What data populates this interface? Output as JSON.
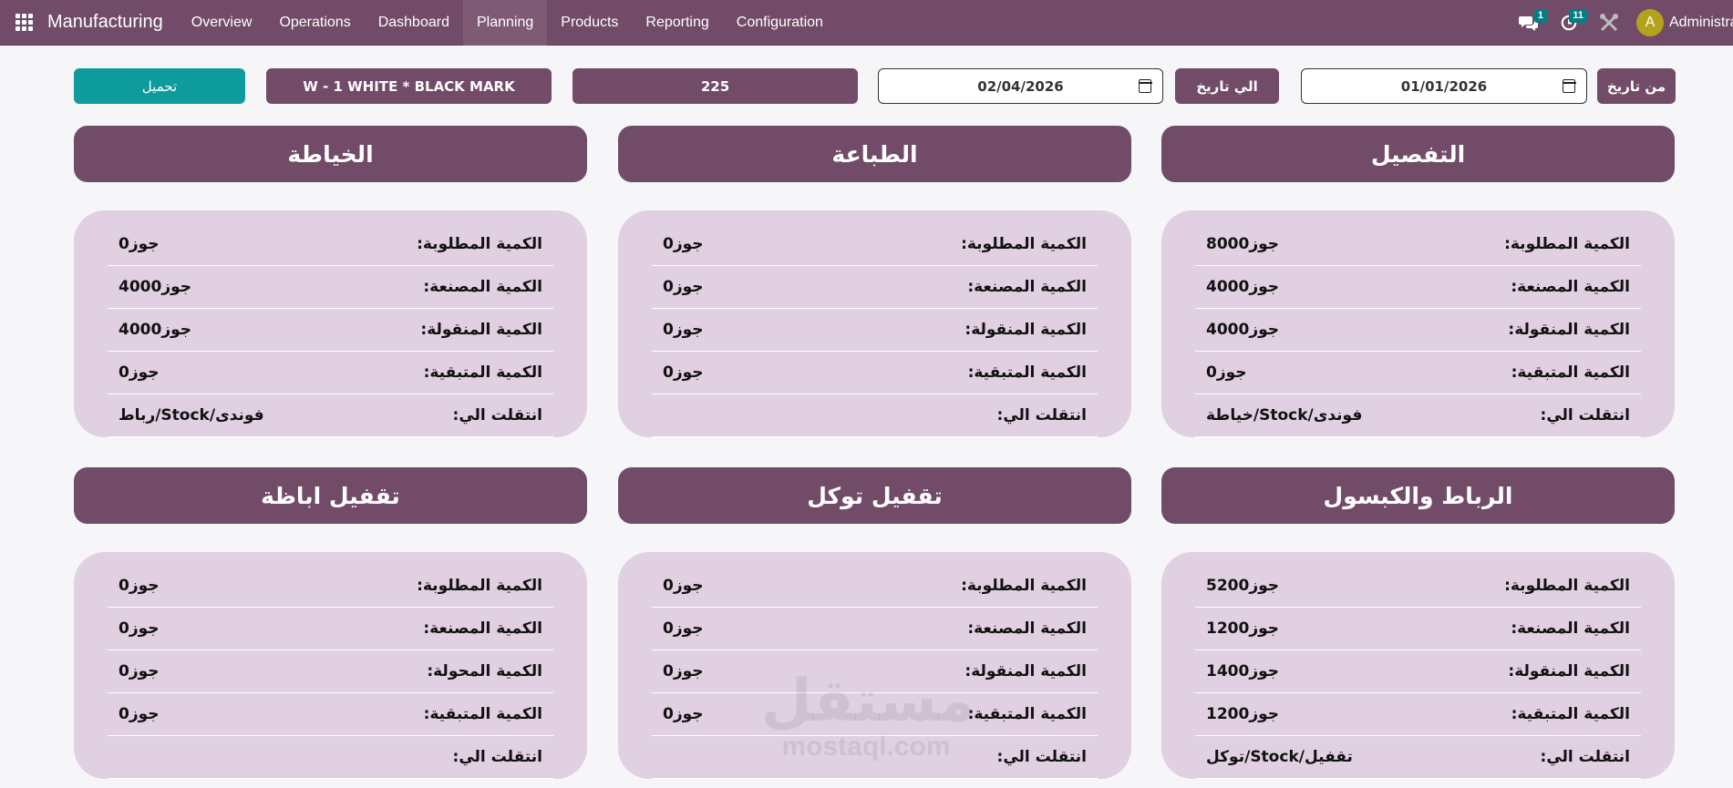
{
  "navbar": {
    "app_name": "Manufacturing",
    "menu": [
      "Overview",
      "Operations",
      "Dashboard",
      "Planning",
      "Products",
      "Reporting",
      "Configuration"
    ],
    "active_menu": "Planning",
    "messages_badge": "1",
    "activities_badge": "11",
    "avatar_letter": "A",
    "user_name": "Administrator"
  },
  "filters": {
    "from_label": "من تاريخ",
    "from_date": "01/01/2026",
    "to_label": "الي تاريخ",
    "to_date": "02/04/2026",
    "quantity": "225",
    "product": "W - 1 WHITE * BLACK MARK",
    "load_button": "تحميل"
  },
  "sections": [
    {
      "title": "التفصيل",
      "rows": [
        {
          "label": "الكمية المطلوبة:",
          "value": "جوز8000"
        },
        {
          "label": "الكمية المصنعة:",
          "value": "جوز4000"
        },
        {
          "label": "الكمية المنقولة:",
          "value": "جوز4000"
        },
        {
          "label": "الكمية المتبقية:",
          "value": "جوز0"
        },
        {
          "label": "انتقلت الي:",
          "value": "فوندى/Stock/خياطة"
        }
      ]
    },
    {
      "title": "الطباعة",
      "rows": [
        {
          "label": "الكمية المطلوبة:",
          "value": "جوز0"
        },
        {
          "label": "الكمية المصنعة:",
          "value": "جوز0"
        },
        {
          "label": "الكمية المنقولة:",
          "value": "جوز0"
        },
        {
          "label": "الكمية المتبقية:",
          "value": "جوز0"
        },
        {
          "label": "انتقلت الي:",
          "value": ""
        }
      ]
    },
    {
      "title": "الخياطة",
      "rows": [
        {
          "label": "الكمية المطلوبة:",
          "value": "جوز0"
        },
        {
          "label": "الكمية المصنعة:",
          "value": "جوز4000"
        },
        {
          "label": "الكمية المنقولة:",
          "value": "جوز4000"
        },
        {
          "label": "الكمية المتبقية:",
          "value": "جوز0"
        },
        {
          "label": "انتقلت الي:",
          "value": "فوندى/Stock/رباط"
        }
      ]
    },
    {
      "title": "الرباط والكبسول",
      "rows": [
        {
          "label": "الكمية المطلوبة:",
          "value": "جوز5200"
        },
        {
          "label": "الكمية المصنعة:",
          "value": "جوز1200"
        },
        {
          "label": "الكمية المنقولة:",
          "value": "جوز1400"
        },
        {
          "label": "الكمية المتبقية:",
          "value": "جوز1200"
        },
        {
          "label": "انتقلت الي:",
          "value": "تقفيل/Stock/توكل"
        }
      ]
    },
    {
      "title": "تقفيل توكل",
      "rows": [
        {
          "label": "الكمية المطلوبة:",
          "value": "جوز0"
        },
        {
          "label": "الكمية المصنعة:",
          "value": "جوز0"
        },
        {
          "label": "الكمية المنقولة:",
          "value": "جوز0"
        },
        {
          "label": "الكمية المتبقية:",
          "value": "جوز0"
        },
        {
          "label": "انتقلت الي:",
          "value": ""
        }
      ]
    },
    {
      "title": "تقفيل اباظة",
      "rows": [
        {
          "label": "الكمية المطلوبة:",
          "value": "جوز0"
        },
        {
          "label": "الكمية المصنعة:",
          "value": "جوز0"
        },
        {
          "label": "الكمية المحولة:",
          "value": "جوز0"
        },
        {
          "label": "الكمية المتبقية:",
          "value": "جوز0"
        },
        {
          "label": "انتقلت الي:",
          "value": ""
        }
      ]
    }
  ],
  "watermark": {
    "arabic": "مستقل",
    "latin": "mostaql.com"
  }
}
